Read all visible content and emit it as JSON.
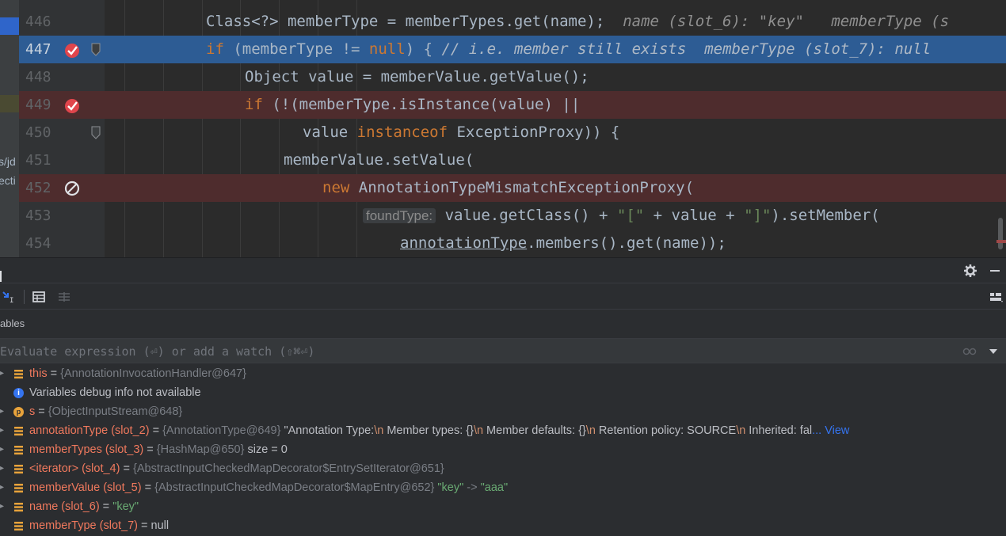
{
  "editor": {
    "left_strip_texts": [
      "s/jd",
      "ecti"
    ],
    "lines": [
      {
        "num": "446",
        "code": "Class<?> memberType = memberTypes.get(name);",
        "hint": "name (slot_6): \"key\"   memberType (s"
      },
      {
        "num": "447",
        "kw1": "if",
        "code_a": " (memberType != ",
        "kw2": "null",
        "code_b": ") { ",
        "comment": "// i.e. member still exists",
        "hint": "memberType (slot_7): null"
      },
      {
        "num": "448",
        "code": "Object value = memberValue.getValue();"
      },
      {
        "num": "449",
        "kw1": "if",
        "code": " (!(memberType.isInstance(value) ||"
      },
      {
        "num": "450",
        "code_a": "value ",
        "kw1": "instanceof",
        "code_b": " ExceptionProxy)) {"
      },
      {
        "num": "451",
        "code": "memberValue.setValue("
      },
      {
        "num": "452",
        "kw1": "new",
        "code": " AnnotationTypeMismatchExceptionProxy("
      },
      {
        "num": "453",
        "param_hint": "foundType:",
        "code_a": " value.getClass() + ",
        "str1": "\"[\"",
        "code_b": " + value + ",
        "str2": "\"]\"",
        "code_c": ").setMember("
      },
      {
        "num": "454",
        "link": "annotationType",
        "code": ".members().get(name));"
      }
    ]
  },
  "debug": {
    "variables_title": "ables",
    "eval_placeholder": "Evaluate expression (⏎) or add a watch (⇧⌘⏎)",
    "rows": [
      {
        "name": "this",
        "eq": " = ",
        "type": "{AnnotationInvocationHandler@647}"
      },
      {
        "info": "Variables debug info not available"
      },
      {
        "name": "s",
        "eq": " = ",
        "type": "{ObjectInputStream@648}"
      },
      {
        "name": "annotationType (slot_2)",
        "eq": " = ",
        "type": "{AnnotationType@649}",
        "val1": " \"Annotation Type:",
        "nl1": "\\n",
        "val2": "   Member types: {}",
        "nl2": "\\n",
        "val3": "   Member defaults: {}",
        "nl3": "\\n",
        "val4": "   Retention policy: SOURCE",
        "nl4": "\\n",
        "val5": "   Inherited: fal",
        "link": "... View"
      },
      {
        "name": "memberTypes (slot_3)",
        "eq": " = ",
        "type": "{HashMap@650}",
        "extra": "  size = 0"
      },
      {
        "name": "<iterator> (slot_4)",
        "eq": " = ",
        "type": "{AbstractInputCheckedMapDecorator$EntrySetIterator@651}"
      },
      {
        "name": "memberValue (slot_5)",
        "eq": " = ",
        "type": "{AbstractInputCheckedMapDecorator$MapEntry@652}",
        "s1": " \"key\"",
        "arrow": " -> ",
        "s2": "\"aaa\""
      },
      {
        "name": "name (slot_6)",
        "eq": " = ",
        "s1": "\"key\""
      },
      {
        "name": "memberType (slot_7)",
        "eq": " = ",
        "extra": "null"
      }
    ]
  },
  "colors": {
    "highlight": "#2d5c94",
    "breakpoint_line": "#4e2c2d",
    "breakpoint": "#e0454c"
  }
}
